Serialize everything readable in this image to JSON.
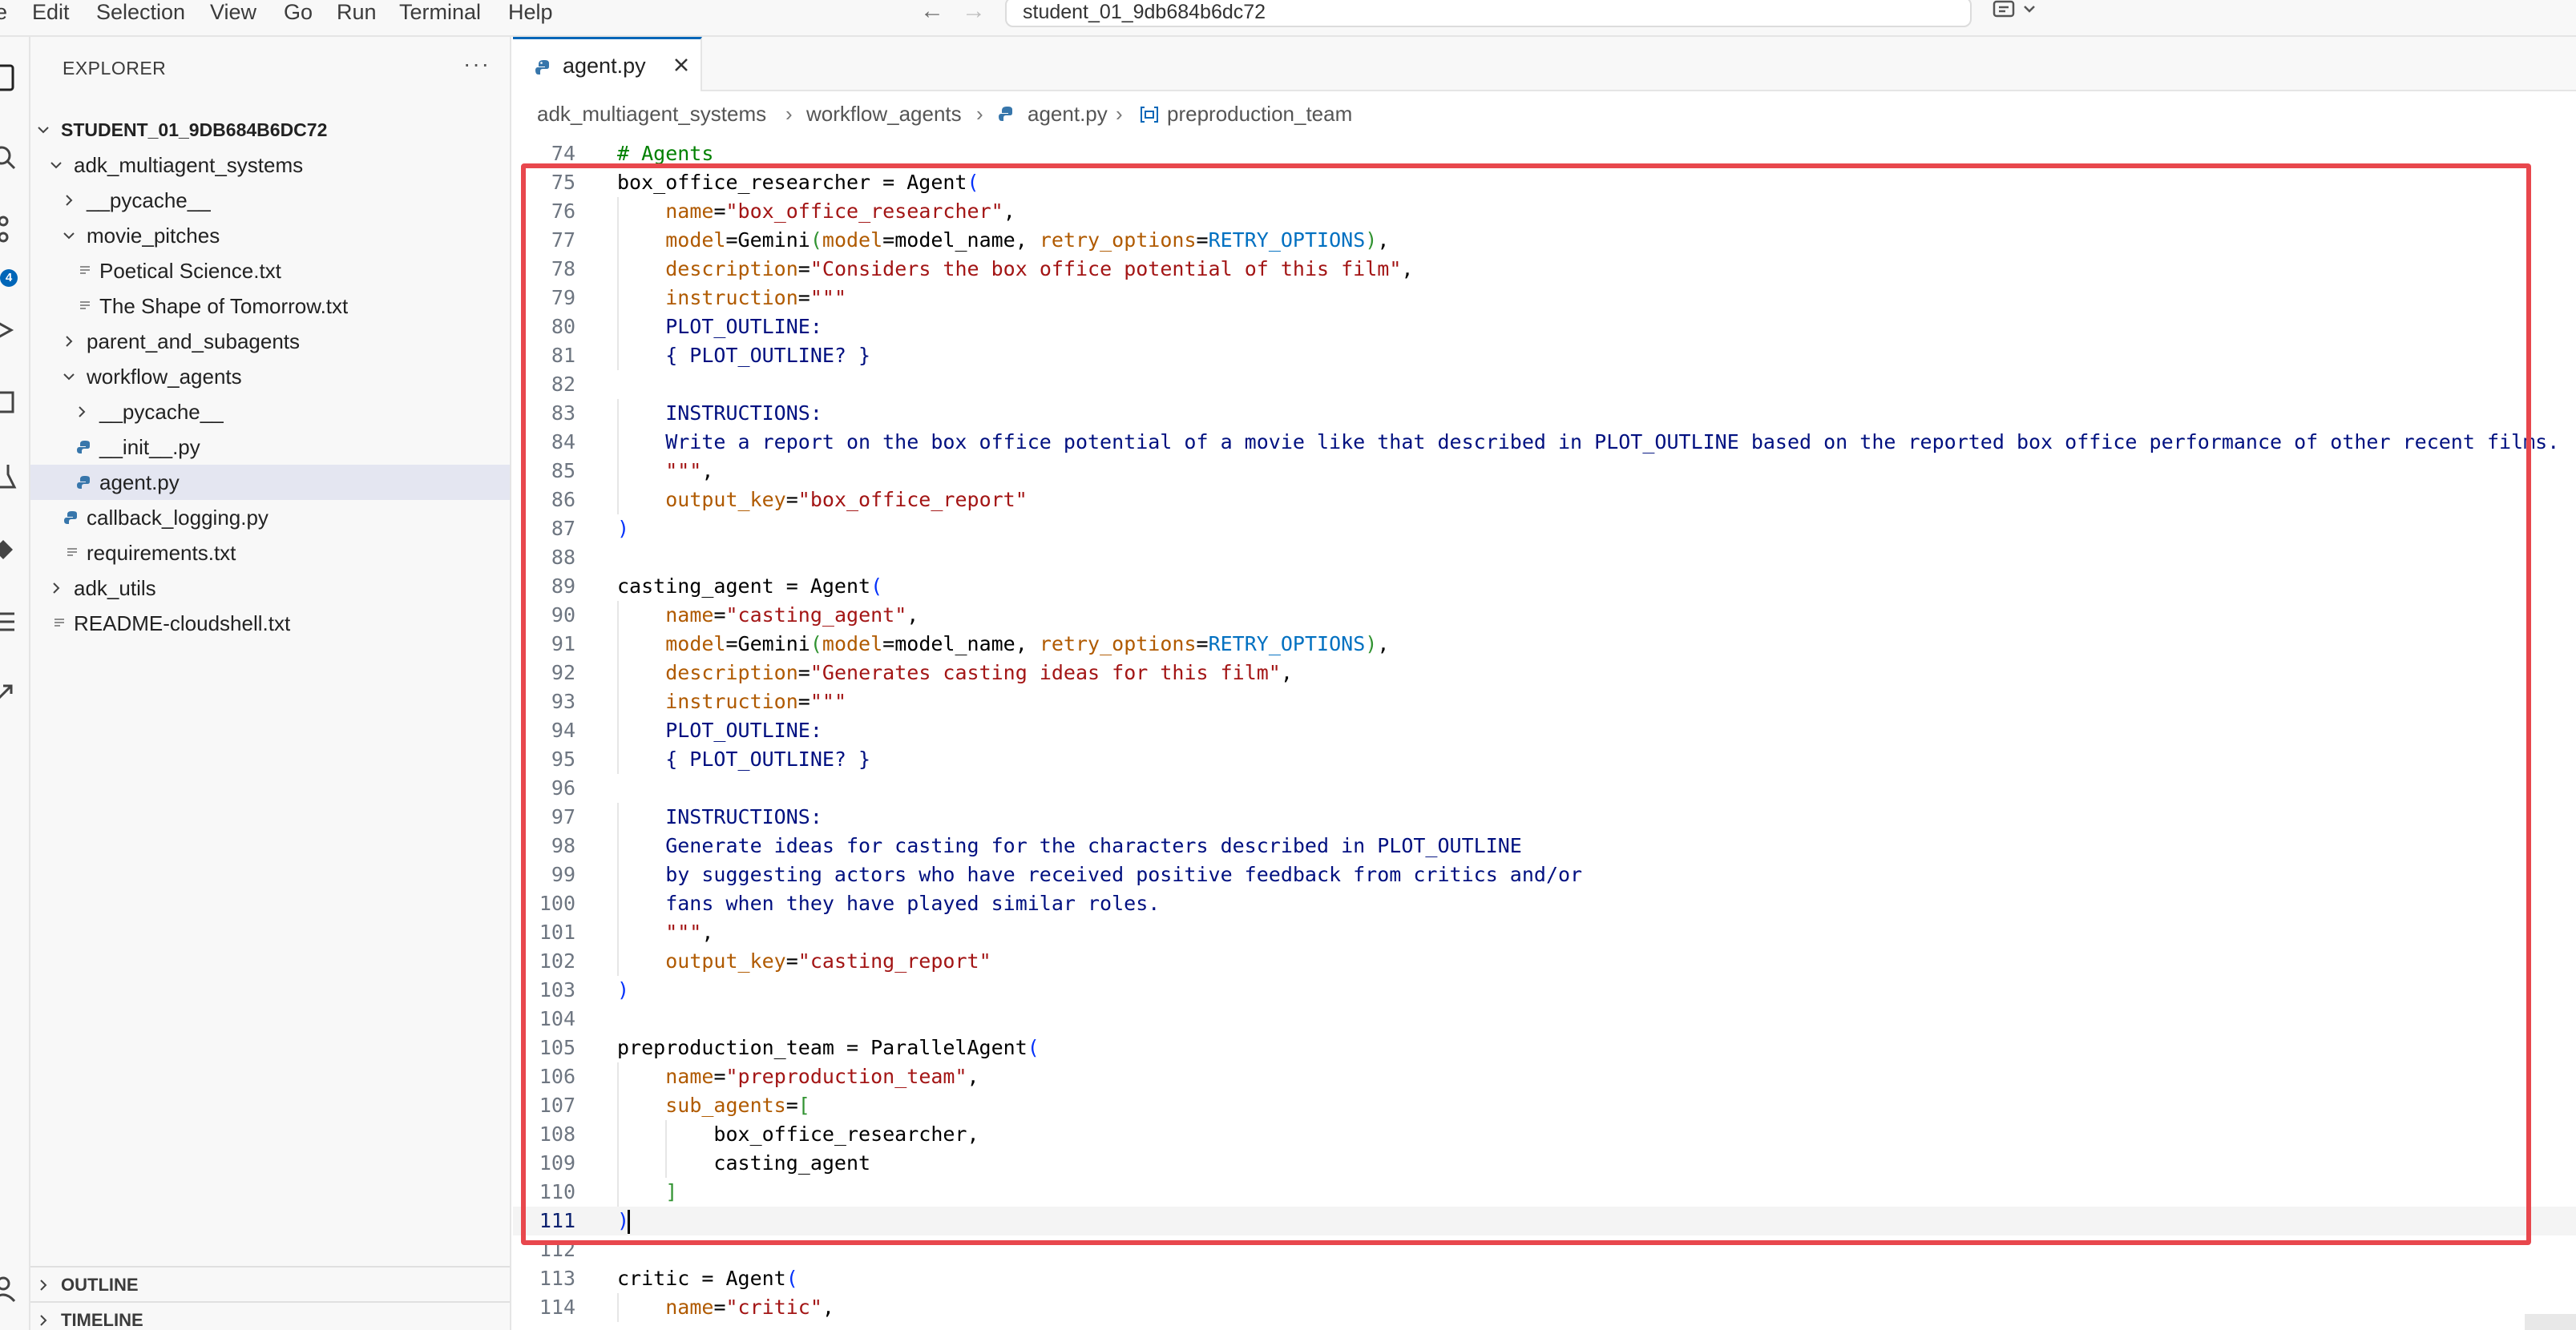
{
  "menu": {
    "items": [
      "e",
      "Edit",
      "Selection",
      "View",
      "Go",
      "Run",
      "Terminal",
      "Help"
    ]
  },
  "command_center": {
    "text": "student_01_9db684b6dc72"
  },
  "activity_bar": {
    "badge_count": "4"
  },
  "explorer": {
    "title": "EXPLORER",
    "root": "STUDENT_01_9DB684B6DC72",
    "tree": [
      {
        "label": "adk_multiagent_systems",
        "depth": 1,
        "type": "folder",
        "expanded": true
      },
      {
        "label": "__pycache__",
        "depth": 2,
        "type": "folder",
        "expanded": false
      },
      {
        "label": "movie_pitches",
        "depth": 2,
        "type": "folder",
        "expanded": true
      },
      {
        "label": "Poetical Science.txt",
        "depth": 3,
        "type": "text"
      },
      {
        "label": "The Shape of Tomorrow.txt",
        "depth": 3,
        "type": "text"
      },
      {
        "label": "parent_and_subagents",
        "depth": 2,
        "type": "folder",
        "expanded": false
      },
      {
        "label": "workflow_agents",
        "depth": 2,
        "type": "folder",
        "expanded": true
      },
      {
        "label": "__pycache__",
        "depth": 3,
        "type": "folder",
        "expanded": false
      },
      {
        "label": "__init__.py",
        "depth": 3,
        "type": "python"
      },
      {
        "label": "agent.py",
        "depth": 3,
        "type": "python",
        "selected": true
      },
      {
        "label": "callback_logging.py",
        "depth": 2,
        "type": "python"
      },
      {
        "label": "requirements.txt",
        "depth": 2,
        "type": "text"
      },
      {
        "label": "adk_utils",
        "depth": 1,
        "type": "folder",
        "expanded": false
      },
      {
        "label": "README-cloudshell.txt",
        "depth": 1,
        "type": "text"
      }
    ],
    "outline_label": "OUTLINE",
    "timeline_label": "TIMELINE"
  },
  "tab": {
    "label": "agent.py"
  },
  "breadcrumb": {
    "items": [
      "adk_multiagent_systems",
      "workflow_agents",
      "agent.py",
      "preproduction_team"
    ]
  },
  "editor": {
    "current_line": "111",
    "lines": [
      {
        "n": "74",
        "tokens": [
          [
            "cm",
            "# Agents"
          ]
        ]
      },
      {
        "n": "75",
        "tokens": [
          [
            "",
            "box_office_researcher = Agent"
          ],
          [
            "br1",
            "("
          ]
        ]
      },
      {
        "n": "76",
        "tokens": [
          [
            "",
            "    "
          ],
          [
            "param",
            "name"
          ],
          [
            "",
            "="
          ],
          [
            "str",
            "\"box_office_researcher\""
          ],
          [
            "",
            ","
          ]
        ]
      },
      {
        "n": "77",
        "tokens": [
          [
            "",
            "    "
          ],
          [
            "param",
            "model"
          ],
          [
            "",
            "=Gemini"
          ],
          [
            "br2",
            "("
          ],
          [
            "param",
            "model"
          ],
          [
            "",
            "=model_name, "
          ],
          [
            "param",
            "retry_options"
          ],
          [
            "",
            "="
          ],
          [
            "con",
            "RETRY_OPTIONS"
          ],
          [
            "br2",
            ")"
          ],
          [
            "",
            ","
          ]
        ]
      },
      {
        "n": "78",
        "tokens": [
          [
            "",
            "    "
          ],
          [
            "param",
            "description"
          ],
          [
            "",
            "="
          ],
          [
            "str",
            "\"Considers the box office potential of this film\""
          ],
          [
            "",
            ","
          ]
        ]
      },
      {
        "n": "79",
        "tokens": [
          [
            "",
            "    "
          ],
          [
            "param",
            "instruction"
          ],
          [
            "",
            "="
          ],
          [
            "str",
            "\"\"\""
          ]
        ]
      },
      {
        "n": "80",
        "tokens": [
          [
            "doc",
            "    PLOT_OUTLINE:"
          ]
        ]
      },
      {
        "n": "81",
        "tokens": [
          [
            "doc",
            "    { PLOT_OUTLINE? }"
          ]
        ]
      },
      {
        "n": "82",
        "tokens": []
      },
      {
        "n": "83",
        "tokens": [
          [
            "doc",
            "    INSTRUCTIONS:"
          ]
        ]
      },
      {
        "n": "84",
        "tokens": [
          [
            "doc",
            "    Write a report on the box office potential of a movie like that described in PLOT_OUTLINE based on the reported box office performance of other recent films."
          ]
        ]
      },
      {
        "n": "85",
        "tokens": [
          [
            "str",
            "    \"\"\""
          ],
          [
            "",
            ","
          ]
        ]
      },
      {
        "n": "86",
        "tokens": [
          [
            "",
            "    "
          ],
          [
            "param",
            "output_key"
          ],
          [
            "",
            "="
          ],
          [
            "str",
            "\"box_office_report\""
          ]
        ]
      },
      {
        "n": "87",
        "tokens": [
          [
            "br1",
            ")"
          ]
        ]
      },
      {
        "n": "88",
        "tokens": []
      },
      {
        "n": "89",
        "tokens": [
          [
            "",
            "casting_agent = Agent"
          ],
          [
            "br1",
            "("
          ]
        ]
      },
      {
        "n": "90",
        "tokens": [
          [
            "",
            "    "
          ],
          [
            "param",
            "name"
          ],
          [
            "",
            "="
          ],
          [
            "str",
            "\"casting_agent\""
          ],
          [
            "",
            ","
          ]
        ]
      },
      {
        "n": "91",
        "tokens": [
          [
            "",
            "    "
          ],
          [
            "param",
            "model"
          ],
          [
            "",
            "=Gemini"
          ],
          [
            "br2",
            "("
          ],
          [
            "param",
            "model"
          ],
          [
            "",
            "=model_name, "
          ],
          [
            "param",
            "retry_options"
          ],
          [
            "",
            "="
          ],
          [
            "con",
            "RETRY_OPTIONS"
          ],
          [
            "br2",
            ")"
          ],
          [
            "",
            ","
          ]
        ]
      },
      {
        "n": "92",
        "tokens": [
          [
            "",
            "    "
          ],
          [
            "param",
            "description"
          ],
          [
            "",
            "="
          ],
          [
            "str",
            "\"Generates casting ideas for this film\""
          ],
          [
            "",
            ","
          ]
        ]
      },
      {
        "n": "93",
        "tokens": [
          [
            "",
            "    "
          ],
          [
            "param",
            "instruction"
          ],
          [
            "",
            "="
          ],
          [
            "str",
            "\"\"\""
          ]
        ]
      },
      {
        "n": "94",
        "tokens": [
          [
            "doc",
            "    PLOT_OUTLINE:"
          ]
        ]
      },
      {
        "n": "95",
        "tokens": [
          [
            "doc",
            "    { PLOT_OUTLINE? }"
          ]
        ]
      },
      {
        "n": "96",
        "tokens": []
      },
      {
        "n": "97",
        "tokens": [
          [
            "doc",
            "    INSTRUCTIONS:"
          ]
        ]
      },
      {
        "n": "98",
        "tokens": [
          [
            "doc",
            "    Generate ideas for casting for the characters described in PLOT_OUTLINE"
          ]
        ]
      },
      {
        "n": "99",
        "tokens": [
          [
            "doc",
            "    by suggesting actors who have received positive feedback from critics and/or"
          ]
        ]
      },
      {
        "n": "100",
        "tokens": [
          [
            "doc",
            "    fans when they have played similar roles."
          ]
        ]
      },
      {
        "n": "101",
        "tokens": [
          [
            "str",
            "    \"\"\""
          ],
          [
            "",
            ","
          ]
        ]
      },
      {
        "n": "102",
        "tokens": [
          [
            "",
            "    "
          ],
          [
            "param",
            "output_key"
          ],
          [
            "",
            "="
          ],
          [
            "str",
            "\"casting_report\""
          ]
        ]
      },
      {
        "n": "103",
        "tokens": [
          [
            "br1",
            ")"
          ]
        ]
      },
      {
        "n": "104",
        "tokens": []
      },
      {
        "n": "105",
        "tokens": [
          [
            "",
            "preproduction_team = ParallelAgent"
          ],
          [
            "br1",
            "("
          ]
        ]
      },
      {
        "n": "106",
        "tokens": [
          [
            "",
            "    "
          ],
          [
            "param",
            "name"
          ],
          [
            "",
            "="
          ],
          [
            "str",
            "\"preproduction_team\""
          ],
          [
            "",
            ","
          ]
        ]
      },
      {
        "n": "107",
        "tokens": [
          [
            "",
            "    "
          ],
          [
            "param",
            "sub_agents"
          ],
          [
            "",
            "="
          ],
          [
            "br2",
            "["
          ]
        ]
      },
      {
        "n": "108",
        "tokens": [
          [
            "",
            "        box_office_researcher,"
          ]
        ]
      },
      {
        "n": "109",
        "tokens": [
          [
            "",
            "        casting_agent"
          ]
        ]
      },
      {
        "n": "110",
        "tokens": [
          [
            "",
            "    "
          ],
          [
            "br2",
            "]"
          ]
        ]
      },
      {
        "n": "111",
        "tokens": [
          [
            "br1",
            ")"
          ],
          [
            "cursor",
            ""
          ]
        ]
      },
      {
        "n": "112",
        "tokens": []
      },
      {
        "n": "113",
        "tokens": [
          [
            "",
            "critic = Agent"
          ],
          [
            "br1",
            "("
          ]
        ]
      },
      {
        "n": "114",
        "tokens": [
          [
            "",
            "    "
          ],
          [
            "param",
            "name"
          ],
          [
            "",
            "="
          ],
          [
            "str",
            "\"critic\""
          ],
          [
            "",
            ","
          ]
        ]
      }
    ]
  },
  "colors": {
    "accent": "#0066b8",
    "highlight_box": "#e8474d",
    "param": "#b05a00",
    "string": "#a31515",
    "constant": "#0070c1"
  }
}
